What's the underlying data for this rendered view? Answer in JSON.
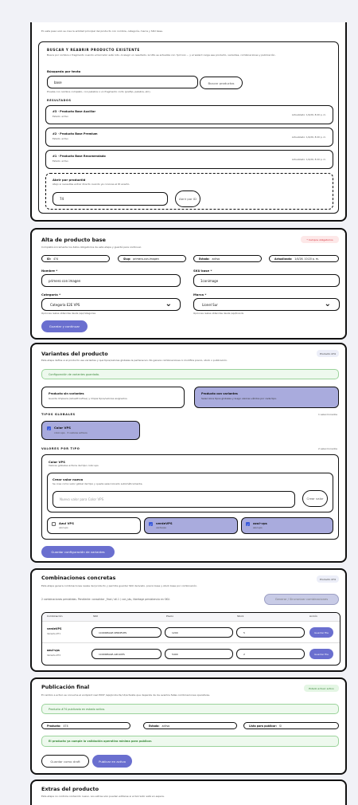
{
  "search_card": {
    "intro": "En este paso solo se crea la entidad principal del producto con nombre, categoría, marca y SKU base.",
    "section_title": "BUSCAR Y REABRIR PRODUCTO EXISTENTE",
    "section_desc": "Busca por nombre o fragmento cuando el borrador esté roto. Al elegir un resultado, la URL se actualiza con ?pi=xxx ... y el wizard carga ese producto, variantes, combinaciones y publicación.",
    "search_label": "Búsqueda por texto",
    "search_value": "base",
    "search_button": "Buscar productos",
    "search_hint": "Prueba con nombre completo, con palabra o un fragmento corto (prefijo, palabra, etc).",
    "results_title": "RESULTADOS",
    "results": [
      {
        "name": "#3 · Producto Base Auxiliar",
        "status": "Estado: activo",
        "updated": "Actualizado: 1/4/26, 8:20 p. m."
      },
      {
        "name": "#2 · Producto Base Premium",
        "status": "Estado: activo",
        "updated": "Actualizado: 1/4/26, 8:20 p. m."
      },
      {
        "name": "#1 · Producto Base Recomendado",
        "status": "Estado: activo",
        "updated": "Actualizado: 1/4/26, 8:20 p. m."
      }
    ],
    "open_id_label": "Abrir por productId",
    "open_id_hint": "Atajo si necesitas entrar directo cuando ya conoces el ID exacto.",
    "open_id_value": "74",
    "open_id_button": "Abrir por ID"
  },
  "alta_card": {
    "title": "Alta de producto base",
    "required_badge": "* Campos obligatorios",
    "desc": "Completá únicamente los datos obligatorios de esta etapa y guardá para continuar.",
    "chips": [
      {
        "k": "ID:",
        "v": "474"
      },
      {
        "k": "Slug:",
        "v": "primero-con-imagen"
      },
      {
        "k": "Estado:",
        "v": "activo"
      },
      {
        "k": "Actualizado:",
        "v": "1/4/26, 10:20 p. m."
      }
    ],
    "name_label": "Nombre *",
    "name_value": "primero con imagen",
    "sku_label": "SKU base *",
    "sku_value": "1conimage",
    "category_label": "Categoría *",
    "category_value": "Categoría E2E VPS",
    "category_hint": "Opciones reales obtenidas desde /api/categories",
    "brand_label": "Marca *",
    "brand_value": "Lionel Sur",
    "brand_hint": "Opciones reales obtenidas desde /api/brands",
    "save_button": "Guardar y continuar"
  },
  "variants_card": {
    "title": "Variantes del producto",
    "badge": "Producto 474",
    "desc": "Esta etapa define si el producto usa variantes y qué tipos/valores globales le pertenecen. No genera combinaciones ni modifica precio, stock o publicación.",
    "status_banner": "Configuración de variantes guardada.",
    "opt_without_title": "Producto sin variantes",
    "opt_without_desc": "Guarda limpieza (isUsePriceTree) y limpia tipos/valores asignados.",
    "opt_with_title": "Producto con variantes",
    "opt_with_desc": "Selecciona tipos globales y luego valores válidos por cada tipo.",
    "global_types_title": "TIPOS GLOBALES",
    "global_types_count": "1 seleccionados",
    "type_name": "Color VPS",
    "type_meta": "color-vps · 3 valores activos",
    "values_title": "VALORES POR TIPO",
    "values_count": "2 seleccionados",
    "color_block_title": "Color VPS",
    "color_block_desc": "Valores globales activos del tipo color-vps",
    "create_value_title": "Crear valor nuevo",
    "create_value_desc": "Se crea como valor global del tipo y queda seleccionado automáticamente.",
    "new_value_placeholder": "Nuevo valor para Color VPS",
    "create_value_button": "Crear valor",
    "values": [
      {
        "name": "Azul VPS",
        "slug": "azul-vps",
        "checked": false
      },
      {
        "name": "verdeVPS",
        "slug": "verdevps",
        "checked": true
      },
      {
        "name": "azul-vps",
        "slug": "azul-vps",
        "checked": true
      }
    ],
    "save_button": "Guardar configuración de variantes"
  },
  "combos_card": {
    "title": "Combinaciones concretas",
    "badge": "Producto 474",
    "desc": "Esta etapa genera combinaciones reales del producto y permite guardar SKU derivado, precio base y stock base por combinación.",
    "pending_text": "2 combinaciones persistidas. Pendiente: consolidar _final / all.1 / con_sku, libertage persistencia en SKU.",
    "generate_button": "Generar / Sincronizar combinaciones",
    "headers": [
      "Combinación",
      "SKU",
      "Precio",
      "Stock",
      "Acción"
    ],
    "rows": [
      {
        "name": "verdeVPS",
        "variant": "Variante #71",
        "sku": "1CONIMAGE-VERDEVPS",
        "price": "1200",
        "stock": "5",
        "action": "Guardar fila"
      },
      {
        "name": "azul-vps",
        "variant": "Variante #72",
        "sku": "1CONIMAGE-AZULVPS",
        "price": "5400",
        "stock": "2",
        "action": "Guardar fila"
      }
    ]
  },
  "publish_card": {
    "title": "Publicación final",
    "badge": "Estado actual: activo",
    "desc": "El cambio a activo se consume el endpoint real POST /api/products/:id/activate que depende de los eventos fallas combinaciones operativas.",
    "banner": "Producto #74 publicado en estado activo.",
    "chips": [
      {
        "k": "Producto:",
        "v": "474"
      },
      {
        "k": "Estado:",
        "v": "activo"
      },
      {
        "k": "Lista para publicar:",
        "v": "Sí"
      }
    ],
    "check_banner": "El producto ya cumple la validación operativa mínima para publicar.",
    "draft_button": "Guardar como draft",
    "publish_button": "Publicar en activo"
  },
  "extras_card": {
    "title": "Extras del producto",
    "desc": "Esta etapa no controla contenido nuevo. Los extras solo pueden editarse si el borrador está en espera."
  },
  "colors": {
    "accent": "#6a6fcf",
    "selected": "#a9abdd",
    "success_bg": "#eef9ee",
    "danger": "#d9303a"
  }
}
